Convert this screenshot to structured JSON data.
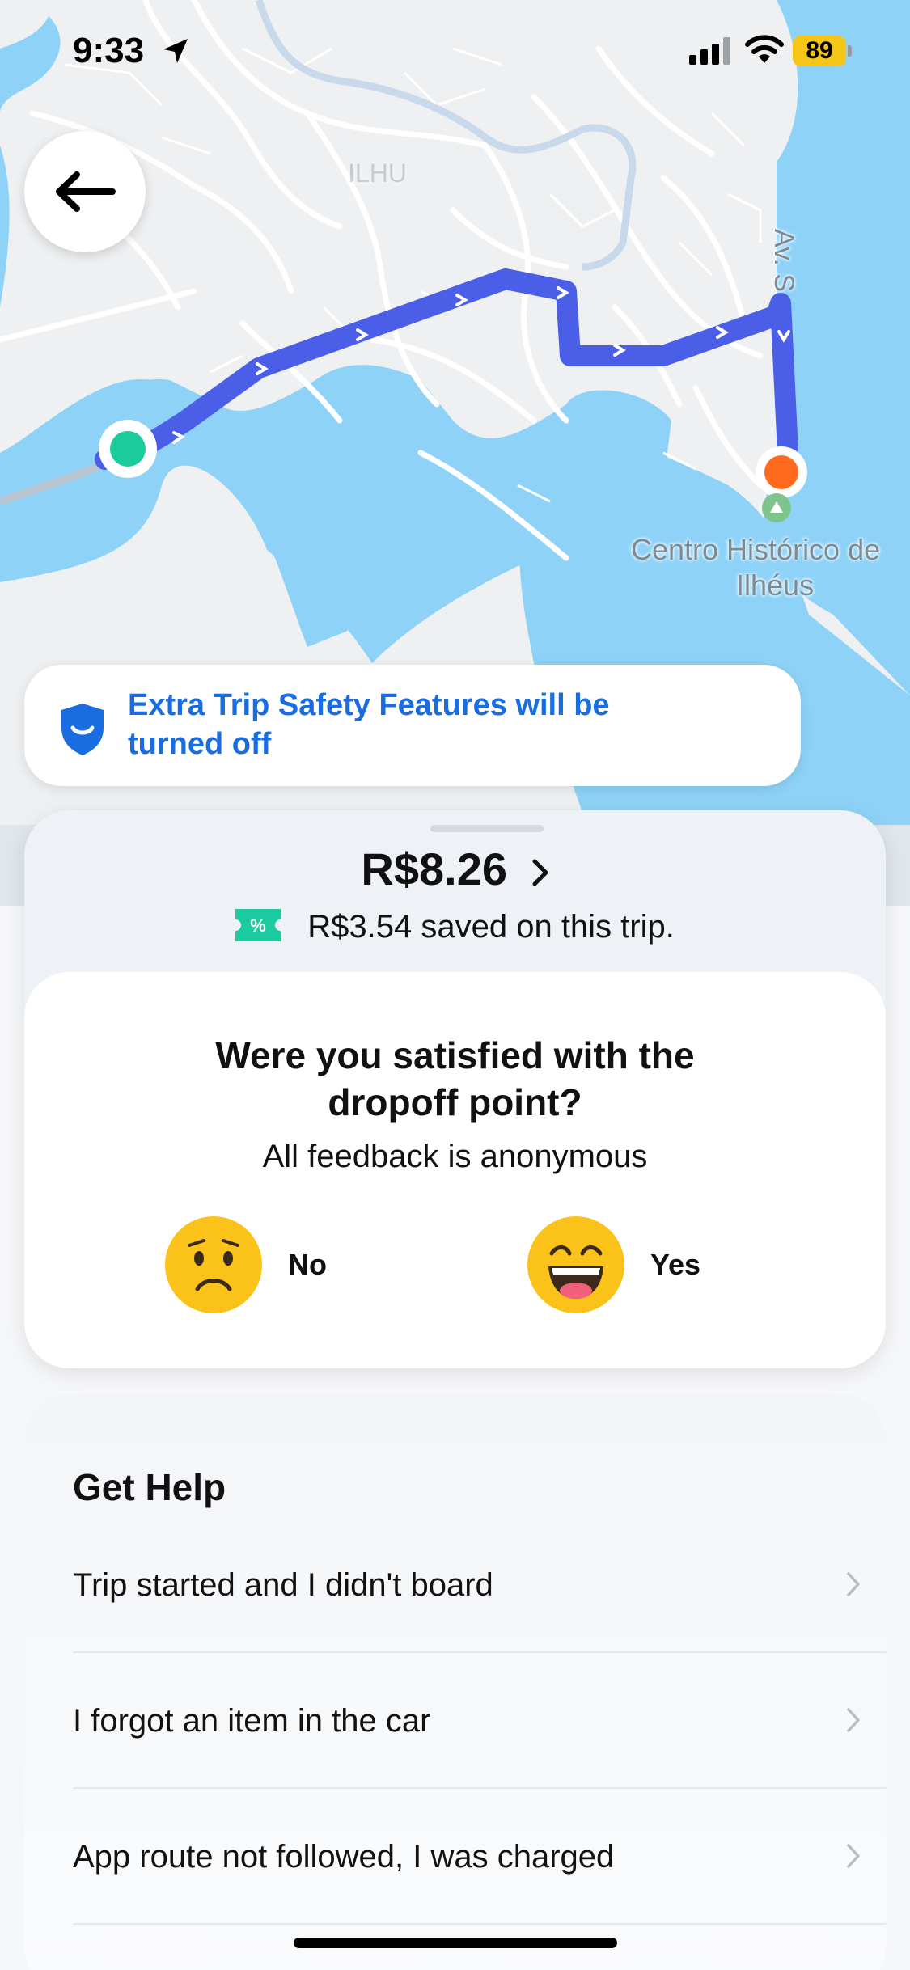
{
  "status_bar": {
    "time": "9:33",
    "battery": "89",
    "battery_color": "#f5c518"
  },
  "map": {
    "street_label": "Av. S",
    "place_label_line1": "Centro Histórico de",
    "place_label_line2": "Ilhéus",
    "faint_label": "ILHU",
    "route_color": "#4a5ee8",
    "water_color": "#8ed3f7",
    "pickup_color": "#1ccb9b",
    "dropoff_color": "#ff6a1f"
  },
  "navigation": {
    "back_icon": "arrow-left-icon"
  },
  "safety_banner": {
    "icon": "shield-icon",
    "text": "Extra Trip Safety Features will be turned off",
    "color": "#1a6de0"
  },
  "trip_summary": {
    "fare": "R$8.26",
    "savings": "R$3.54 saved on this trip.",
    "coupon_icon": "percent-ticket-icon"
  },
  "feedback": {
    "question": "Were you satisfied with the dropoff point?",
    "subtitle": "All feedback is anonymous",
    "options": [
      {
        "label": "No",
        "icon": "sad-face-icon"
      },
      {
        "label": "Yes",
        "icon": "happy-face-icon"
      }
    ]
  },
  "help": {
    "title": "Get Help",
    "items": [
      {
        "label": "Trip started and I didn't board"
      },
      {
        "label": "I forgot an item in the car"
      },
      {
        "label": "App route not followed, I was charged"
      }
    ]
  }
}
